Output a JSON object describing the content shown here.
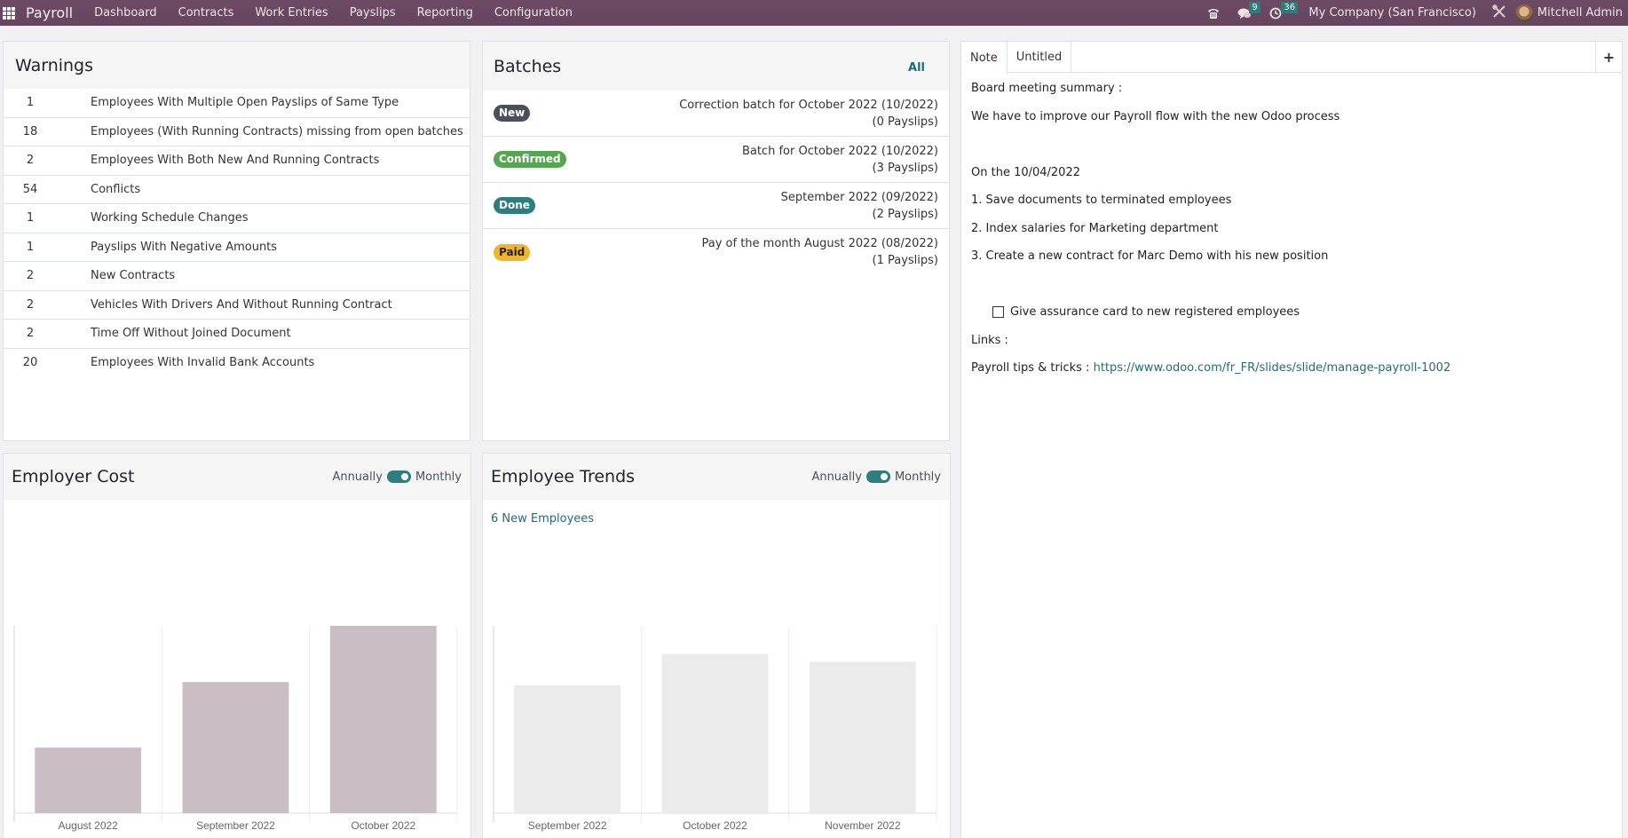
{
  "navbar": {
    "app_name": "Payroll",
    "menu": [
      "Dashboard",
      "Contracts",
      "Work Entries",
      "Payslips",
      "Reporting",
      "Configuration"
    ],
    "icons": [
      "phone-icon",
      "chat-icon",
      "clock-icon"
    ],
    "messages_count": "9",
    "activities_count": "36",
    "company": "My Company (San Francisco)",
    "user": "Mitchell Admin"
  },
  "warnings": {
    "title": "Warnings",
    "rows": [
      {
        "count": "1",
        "label": "Employees With Multiple Open Payslips of Same Type"
      },
      {
        "count": "18",
        "label": "Employees (With Running Contracts) missing from open batches"
      },
      {
        "count": "2",
        "label": "Employees With Both New And Running Contracts"
      },
      {
        "count": "54",
        "label": "Conflicts"
      },
      {
        "count": "1",
        "label": "Working Schedule Changes"
      },
      {
        "count": "1",
        "label": "Payslips With Negative Amounts"
      },
      {
        "count": "2",
        "label": "New Contracts"
      },
      {
        "count": "2",
        "label": "Vehicles With Drivers And Without Running Contract"
      },
      {
        "count": "2",
        "label": "Time Off Without Joined Document"
      },
      {
        "count": "20",
        "label": "Employees With Invalid Bank Accounts"
      }
    ]
  },
  "batches": {
    "title": "Batches",
    "all_label": "All",
    "rows": [
      {
        "state": "New",
        "state_class": "state-new",
        "name": "Correction batch for October 2022 (10/2022)",
        "payslips": "(0 Payslips)"
      },
      {
        "state": "Confirmed",
        "state_class": "state-confirmed",
        "name": "Batch for October 2022 (10/2022)",
        "payslips": "(3 Payslips)"
      },
      {
        "state": "Done",
        "state_class": "state-done",
        "name": "September 2022 (09/2022)",
        "payslips": "(2 Payslips)"
      },
      {
        "state": "Paid",
        "state_class": "state-paid",
        "name": "Pay of the month August 2022 (08/2022)",
        "payslips": "(1 Payslips)"
      }
    ]
  },
  "note": {
    "tabs": [
      "Note",
      "Untitled"
    ],
    "add_tab": "+",
    "lines": {
      "l1": "Board meeting summary :",
      "l2": "We have to improve our Payroll flow with the new Odoo process",
      "l3": "On the 10/04/2022",
      "l4": "1. Save documents to terminated employees",
      "l5": "2. Index salaries for Marketing department",
      "l6": "3. Create a new contract for Marc Demo with his new position",
      "checkbox": "Give assurance card to new registered employees",
      "links": "Links :",
      "tips_label": "Payroll tips & tricks : ",
      "tips_url": "https://www.odoo.com/fr_FR/slides/slide/manage-payroll-1002"
    },
    "checkbox_checked": false
  },
  "employer_cost": {
    "title": "Employer Cost",
    "toggle_left": "Annually",
    "toggle_right": "Monthly",
    "toggle_state": "Monthly"
  },
  "employee_trends": {
    "title": "Employee Trends",
    "toggle_left": "Annually",
    "toggle_right": "Monthly",
    "toggle_state": "Monthly",
    "new_employees": "6 New Employees"
  },
  "chart_data": [
    {
      "type": "bar",
      "title": "Employer Cost",
      "categories": [
        "August 2022",
        "September 2022",
        "October 2022"
      ],
      "values": [
        35,
        70,
        100
      ],
      "ylim": [
        0,
        100
      ],
      "xlabel": "",
      "ylabel": "",
      "grid": true,
      "color": "#c9bec6",
      "note": "relative values; no y-axis labels shown"
    },
    {
      "type": "bar",
      "title": "Employee Trends",
      "categories": [
        "September 2022",
        "October 2022",
        "November 2022"
      ],
      "values": [
        4.1,
        5.1,
        4.85
      ],
      "ylim": [
        0,
        6
      ],
      "xlabel": "",
      "ylabel": "",
      "grid": true,
      "color": "#ebebeb",
      "note": "estimated values; no y-axis labels shown"
    }
  ]
}
